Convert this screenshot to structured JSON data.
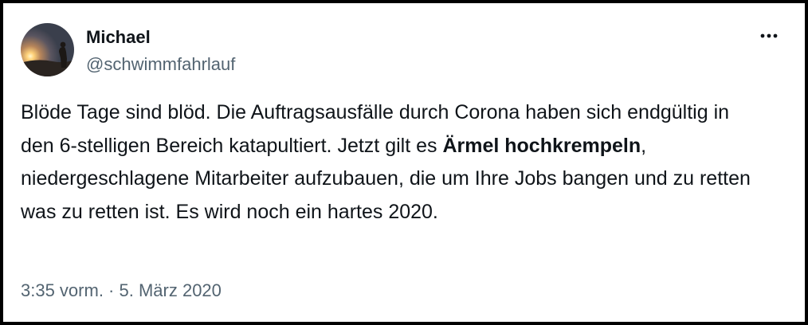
{
  "author": {
    "display_name": "Michael",
    "handle": "@schwimmfahrlauf"
  },
  "tweet": {
    "text_part1": "Blöde Tage sind blöd. Die Auftragsausfälle durch Corona haben sich endgültig in den 6-stelligen Bereich katapultiert. Jetzt gilt es ",
    "text_bold": "Ärmel hochkrempeln",
    "text_part2": ", niedergeschlagene Mitarbeiter aufzubauen, die um Ihre Jobs bangen und zu retten was zu retten ist. Es wird noch ein hartes 2020.",
    "time": "3:35 vorm.",
    "separator": " · ",
    "date": "5. März 2020"
  },
  "icons": {
    "more": "more-horizontal-icon",
    "avatar": "sunset-silhouette-avatar"
  },
  "colors": {
    "text_primary": "#0f1419",
    "text_secondary": "#536471",
    "frame_border": "#000000"
  }
}
